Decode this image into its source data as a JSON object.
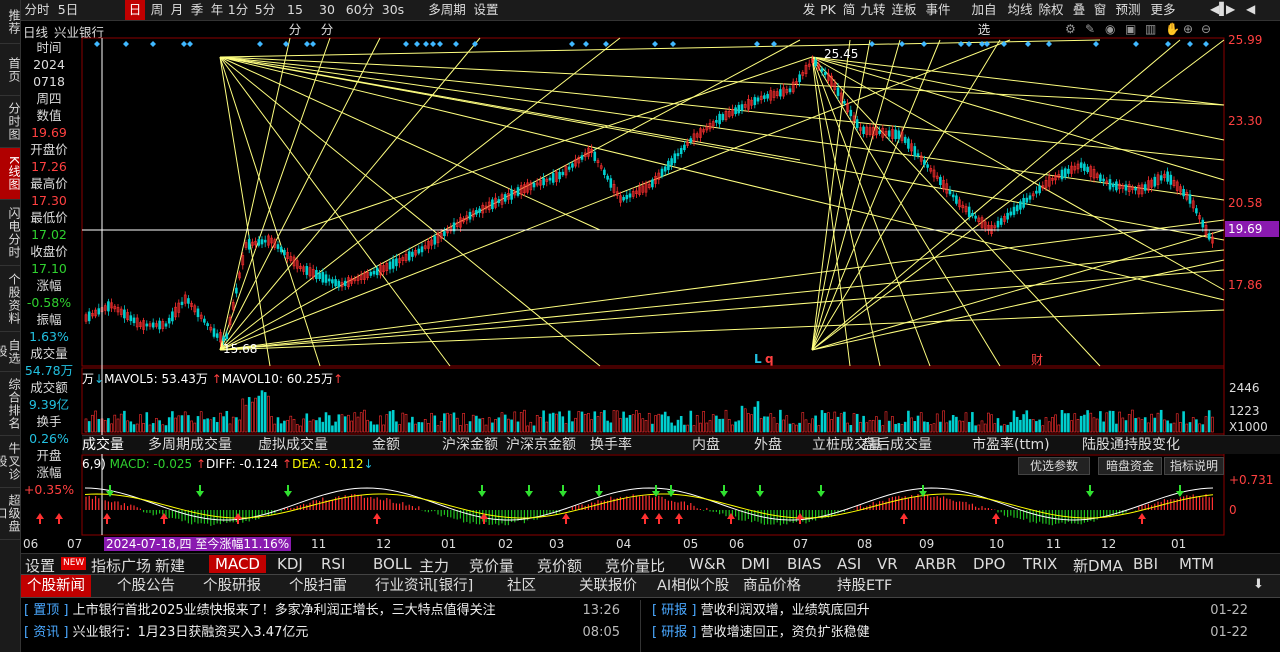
{
  "left_nav": [
    {
      "label": "推荐"
    },
    {
      "label": "首页"
    },
    {
      "label": "分时图"
    },
    {
      "label": "K线图",
      "active": true
    },
    {
      "label": "闪电分时"
    },
    {
      "label": "个股资料"
    },
    {
      "label": "自选股"
    },
    {
      "label": "综合排名"
    },
    {
      "label": "牛叉诊股"
    },
    {
      "label": "超级盘口"
    }
  ],
  "toolbar": {
    "left": [
      "分时",
      "5日",
      "日",
      "周",
      "月",
      "季",
      "年",
      "1分",
      "5分",
      "15分",
      "30分",
      "60分",
      "30s",
      "多周期",
      "设置"
    ],
    "active": "日",
    "right": [
      "发",
      "PK",
      "简",
      "九转",
      "连板",
      "事件",
      "加自选",
      "均线",
      "除权",
      "叠",
      "窗",
      "预测",
      "更多"
    ]
  },
  "chart_header": {
    "period": "日线",
    "stock": "兴业银行"
  },
  "info": [
    {
      "k": "时间"
    },
    {
      "v": "2024",
      "c": "lbl"
    },
    {
      "v": "0718",
      "c": "lbl"
    },
    {
      "k": "周四"
    },
    {
      "k": "数值"
    },
    {
      "v": "19.69",
      "c": "red"
    },
    {
      "k": "开盘价"
    },
    {
      "v": "17.26",
      "c": "red"
    },
    {
      "k": "最高价"
    },
    {
      "v": "17.30",
      "c": "red"
    },
    {
      "k": "最低价"
    },
    {
      "v": "17.02",
      "c": "grn"
    },
    {
      "k": "收盘价"
    },
    {
      "v": "17.10",
      "c": "grn"
    },
    {
      "k": "涨幅"
    },
    {
      "v": "-0.58%",
      "c": "grn"
    },
    {
      "k": "振幅"
    },
    {
      "v": "1.63%",
      "c": "cyan"
    },
    {
      "k": "成交量"
    },
    {
      "v": "54.78万",
      "c": "cyan"
    },
    {
      "k": "成交额"
    },
    {
      "v": "9.39亿",
      "c": "cyan"
    },
    {
      "k": "换手"
    },
    {
      "v": "0.26%",
      "c": "cyan"
    },
    {
      "k": "开盘"
    },
    {
      "k": "涨幅"
    },
    {
      "v": "+0.35%",
      "c": "red"
    }
  ],
  "price_axis": [
    "25.99",
    "23.30",
    "20.58",
    "17.86"
  ],
  "current_price": "19.69",
  "annotations": {
    "high": "25.45",
    "low": "15.68",
    "l": "L",
    "q": "q",
    "cai": "财"
  },
  "volume": {
    "legend_prefix": "万",
    "mavol5": "MAVOL5: 53.43万",
    "mavol10": "MAVOL10: 60.25万",
    "axis": [
      "2446",
      "1223",
      "X1000"
    ]
  },
  "indicator_tabs": [
    "成交量",
    "多周期成交量",
    "虚拟成交量",
    "金额",
    "沪深金额",
    "沪深京金额",
    "换手率",
    "内盘",
    "外盘",
    "立桩成交量",
    "盘后成交量",
    "市盈率(ttm)",
    "陆股通持股变化"
  ],
  "macd": {
    "prefix": "6,9)",
    "macd": "MACD: -0.025",
    "diff": "DIFF: -0.124",
    "dea": "DEA: -0.112",
    "buttons": [
      "优选参数",
      "暗盘资金",
      "指标说明"
    ],
    "axis": [
      "+0.731",
      "0"
    ]
  },
  "months": [
    "06",
    "07",
    "11",
    "12",
    "01",
    "02",
    "03",
    "04",
    "05",
    "06",
    "07",
    "08",
    "09",
    "10",
    "11",
    "12",
    "01"
  ],
  "date_badge": "2024-07-18,四 至今涨幅11.16%",
  "bottom_tabs": [
    "设置",
    "指标广场",
    "新建",
    "MACD",
    "KDJ",
    "RSI",
    "BOLL",
    "主力",
    "竞价量",
    "竞价额",
    "竞价量比",
    "W&R",
    "DMI",
    "BIAS",
    "ASI",
    "VR",
    "ARBR",
    "DPO",
    "TRIX",
    "新DMA",
    "BBI",
    "MTM"
  ],
  "new_badge": "NEW",
  "news_tabs": [
    "个股新闻",
    "个股公告",
    "个股研报",
    "个股扫雷",
    "行业资讯[银行]",
    "社区",
    "关联报价",
    "AI相似个股",
    "商品价格",
    "持股ETF"
  ],
  "news_left": [
    {
      "tag": "置顶",
      "title": "上市银行首批2025业绩快报来了！多家净利润正增长，三大特点值得关注",
      "time": "13:26"
    },
    {
      "tag": "资讯",
      "title": "兴业银行：1月23日获融资买入3.47亿元",
      "time": "08:05"
    }
  ],
  "news_right": [
    {
      "tag": "研报",
      "title": "营收利润双增，业绩筑底回升",
      "time": "01-22"
    },
    {
      "tag": "研报",
      "title": "营收增速回正，资负扩张稳健",
      "time": "01-22"
    }
  ],
  "colors": {
    "up": "#ff3030",
    "down": "#00d0d0",
    "gann": "#ffff80",
    "macd_line": "#ffffff",
    "dea_line": "#ffff00",
    "accent": "#c00000"
  },
  "icons": [
    "gear-icon",
    "pen-icon",
    "eye-icon",
    "lock-icon",
    "trash-icon",
    "hand-icon",
    "zoom-in-icon",
    "zoom-out-icon"
  ]
}
